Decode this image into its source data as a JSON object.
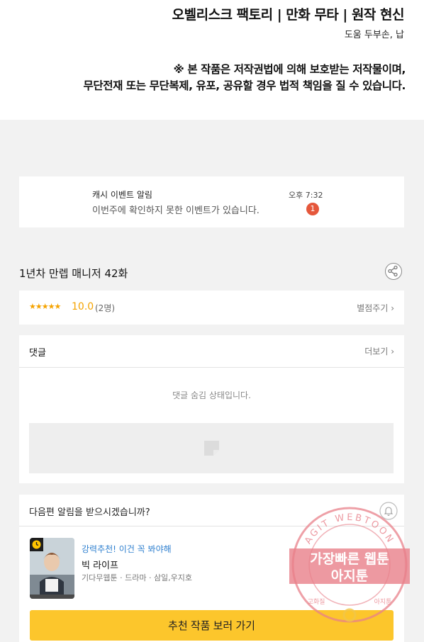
{
  "credits": {
    "title_line": "오벨리스크 팩토리 | 만화 무타 | 원작 현신",
    "assist_line": "도움 두부손, 납"
  },
  "copyright_notice": {
    "line1": "※ 본 작품은 저작권법에 의해 보호받는 저작물이며,",
    "line2": "무단전재 또는 무단복제, 유포, 공유할 경우 법적 책임을 질 수 있습니다."
  },
  "notification": {
    "title": "캐시 이벤트 알림",
    "body": "이번주에 확인하지 못한 이벤트가 있습니다.",
    "time": "오후 7:32",
    "badge_count": "1",
    "badge_color": "#e5573b"
  },
  "episode": {
    "title": "1년차 만렙 매니저 42화",
    "share_icon": "share-icon"
  },
  "rating": {
    "stars": "★★★★★",
    "value": "10.0",
    "count": "(2명)",
    "rate_label": "별점주기 ›",
    "accent_color": "#f5a300"
  },
  "comments": {
    "title": "댓글",
    "more_label": "더보기 ›",
    "hidden_message": "댓글 숨김 상태입니다.",
    "ad_icon": "image-placeholder-icon"
  },
  "next_episode": {
    "question": "다음편 알림을 받으시겠습니까?",
    "bell_icon": "bell-icon",
    "recommend": {
      "tag": "강력추천! 이건 꼭 봐야해",
      "title": "빅 라이프",
      "meta": "기다무웹툰 · 드라마 · 삼일,우지호",
      "thumbnail_label": "빅라이프",
      "clock_icon": "clock-icon"
    },
    "button_label": "추천 작품 보러 가기",
    "button_color": "#fcc62c"
  },
  "watermark": {
    "arc_text": "AGIT WEBTOON",
    "line1": "가장빠른 웹툰",
    "line2": "아지툰",
    "small_left": "고화질",
    "small_right": "아지툰"
  }
}
